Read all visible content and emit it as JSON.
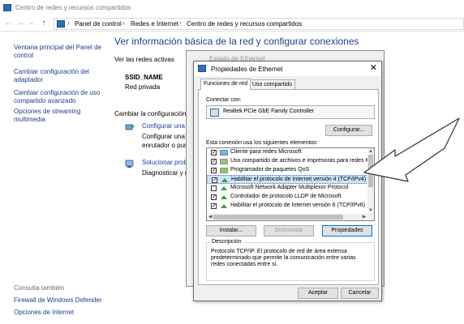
{
  "window": {
    "title": "Centro de redes y recursos compartidos",
    "breadcrumbs": [
      "Panel de control",
      "Redes e Internet",
      "Centro de redes y recursos compartidos"
    ]
  },
  "left_pane": {
    "links": [
      "Ventana principal del Panel de control",
      "Cambiar configuración del adaptador",
      "Cambiar configuración de uso compartido avanzado",
      "Opciones de streaming multimedia"
    ],
    "see_also_heading": "Consulta también",
    "see_also_links": [
      "Firewall de Windows Defender",
      "Opciones de Internet"
    ]
  },
  "main": {
    "title": "Ver información básica de la red y configurar conexiones",
    "active_networks_label": "Ver las redes activas",
    "network_name": "SSID_NAME",
    "network_type": "Red privada",
    "change_settings_label": "Cambiar la configuración d",
    "setup_link": "Configurar una",
    "setup_desc_1": "Configurar una",
    "setup_desc_2": "enrutador o pun",
    "troubleshoot_link": "Solucionar prob",
    "troubleshoot_desc": "Diagnosticar y r"
  },
  "back_dialog": {
    "title": "Estado de Ethernet"
  },
  "dialog": {
    "title": "Propiedades de Ethernet",
    "tabs": [
      "Funciones de red",
      "Uso compartido"
    ],
    "connect_using_label": "Conectar con:",
    "adapter_name": "Realtek PCIe GbE Family Controller",
    "configure_button": "Configurar...",
    "items_label": "Esta conexión usa los siguientes elementos:",
    "items": [
      {
        "label": "Cliente para redes Microsoft",
        "checked": true,
        "icon": "network-client-icon"
      },
      {
        "label": "Uso compartido de archivos e impresoras para redes M",
        "checked": true,
        "icon": "service-icon"
      },
      {
        "label": "Programador de paquetes QoS",
        "checked": true,
        "icon": "service-icon"
      },
      {
        "label": "Habilitar el protocolo de Internet versión 4 (TCP/IPv4)",
        "checked": true,
        "icon": "protocol-icon",
        "selected": true
      },
      {
        "label": "Microsoft Network Adapter Multiplexor Protocol",
        "checked": false,
        "icon": "protocol-icon"
      },
      {
        "label": "Controlador de protocolo LLDP de Microsoft",
        "checked": true,
        "icon": "protocol-icon"
      },
      {
        "label": "Habilitar el protocolo de Internet versión 6 (TCP/IPv6)",
        "checked": true,
        "icon": "protocol-icon"
      }
    ],
    "install_button": "Instalar...",
    "uninstall_button": "Desinstalar",
    "properties_button": "Propiedades",
    "description_heading": "Descripción",
    "description_text": "Protocolo TCP/IP. El protocolo de red de área extensa predeterminado que permite la comunicación entre varias redes conectadas entre sí.",
    "ok_button": "Aceptar",
    "cancel_button": "Cancelar"
  },
  "colors": {
    "link": "#1a3c8f",
    "title_blue": "#1e3f8a",
    "selection": "#cce4f7",
    "accent": "#0078d7"
  }
}
